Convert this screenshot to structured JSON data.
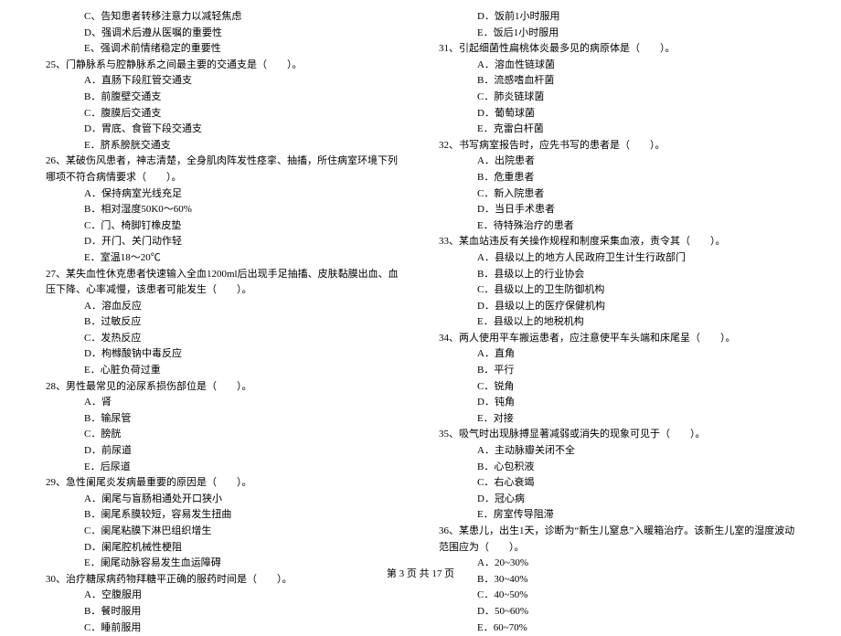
{
  "left": {
    "prelines": [
      "C、告知患者转移注意力以减轻焦虑",
      "D、强调术后遵从医嘱的重要性",
      "E、强调术前情绪稳定的重要性"
    ],
    "questions": [
      {
        "num": "25、",
        "text": "门静脉系与腔静脉系之间最主要的交通支是（　　）。",
        "opts": [
          "A．直肠下段肛管交通支",
          "B．前腹壁交通支",
          "C．腹膜后交通支",
          "D．胃底、食管下段交通支",
          "E．脐系膀胱交通支"
        ]
      },
      {
        "num": "26、",
        "text": "某破伤风患者，神志清楚，全身肌肉阵发性痉挛、抽搐，所住病室环境下列哪项不符合病情要求（　　）。",
        "opts": [
          "A．保持病室光线充足",
          "B．相对湿度50K0～60%",
          "C．门、椅脚钉橡皮垫",
          "D．开门、关门动作轻",
          "E．室温18～20℃"
        ]
      },
      {
        "num": "27、",
        "text": "某失血性休克患者快速输入全血1200ml后出现手足抽搐、皮肤黏膜出血、血压下降、心率减慢，该患者可能发生（　　）。",
        "opts": [
          "A．溶血反应",
          "B．过敏反应",
          "C．发热反应",
          "D．枸橼酸钠中毒反应",
          "E．心脏负荷过重"
        ]
      },
      {
        "num": "28、",
        "text": "男性最常见的泌尿系损伤部位是（　　）。",
        "opts": [
          "A．肾",
          "B．输尿管",
          "C．膀胱",
          "D．前尿道",
          "E．后尿道"
        ]
      },
      {
        "num": "29、",
        "text": "急性阑尾炎发病最重要的原因是（　　）。",
        "opts": [
          "A．阑尾与盲肠相通处开口狭小",
          "B．阑尾系膜较短，容易发生扭曲",
          "C．阑尾粘膜下淋巴组织增生",
          "D．阑尾腔机械性梗阻",
          "E．阑尾动脉容易发生血运障碍"
        ]
      },
      {
        "num": "30、",
        "text": "治疗糖尿病药物拜糖平正确的服药时间是（　　）。",
        "opts": [
          "A．空腹服用",
          "B．餐时服用",
          "C．睡前服用"
        ]
      }
    ]
  },
  "right": {
    "prelines": [
      "D．饭前1小时服用",
      "E．饭后1小时服用"
    ],
    "questions": [
      {
        "num": "31、",
        "text": "引起细菌性扁桃体炎最多见的病原体是（　　）。",
        "opts": [
          "A．溶血性链球菌",
          "B．流感嗜血杆菌",
          "C．肺炎链球菌",
          "D．葡萄球菌",
          "E．克雷白杆菌"
        ]
      },
      {
        "num": "32、",
        "text": "书写病室报告时，应先书写的患者是（　　）。",
        "opts": [
          "A．出院患者",
          "B．危重患者",
          "C．新入院患者",
          "D．当日手术患者",
          "E．待特殊治疗的患者"
        ]
      },
      {
        "num": "33、",
        "text": "某血站违反有关操作规程和制度采集血液，责令其（　　）。",
        "opts": [
          "A．县级以上的地方人民政府卫生计生行政部门",
          "B．县级以上的行业协会",
          "C．县级以上的卫生防御机构",
          "D．县级以上的医疗保健机构",
          "E．县级以上的地税机构"
        ]
      },
      {
        "num": "34、",
        "text": "两人使用平车搬运患者，应注意使平车头端和床尾呈（　　）。",
        "opts": [
          "A．直角",
          "B．平行",
          "C．锐角",
          "D．钝角",
          "E．对接"
        ]
      },
      {
        "num": "35、",
        "text": "吸气时出现脉搏显著减弱或消失的现象可见于（　　）。",
        "opts": [
          "A．主动脉瓣关闭不全",
          "B．心包积液",
          "C．右心衰竭",
          "D．冠心病",
          "E．房室传导阻滞"
        ]
      },
      {
        "num": "36、",
        "text": "某患儿，出生1天，诊断为“新生儿窒息”入暖箱治疗。该新生儿室的湿度波动范围应为（　　）。",
        "opts": [
          "A．20~30%",
          "B．30~40%",
          "C．40~50%",
          "D．50~60%",
          "E．60~70%"
        ]
      }
    ]
  },
  "footer": "第 3 页 共 17 页"
}
